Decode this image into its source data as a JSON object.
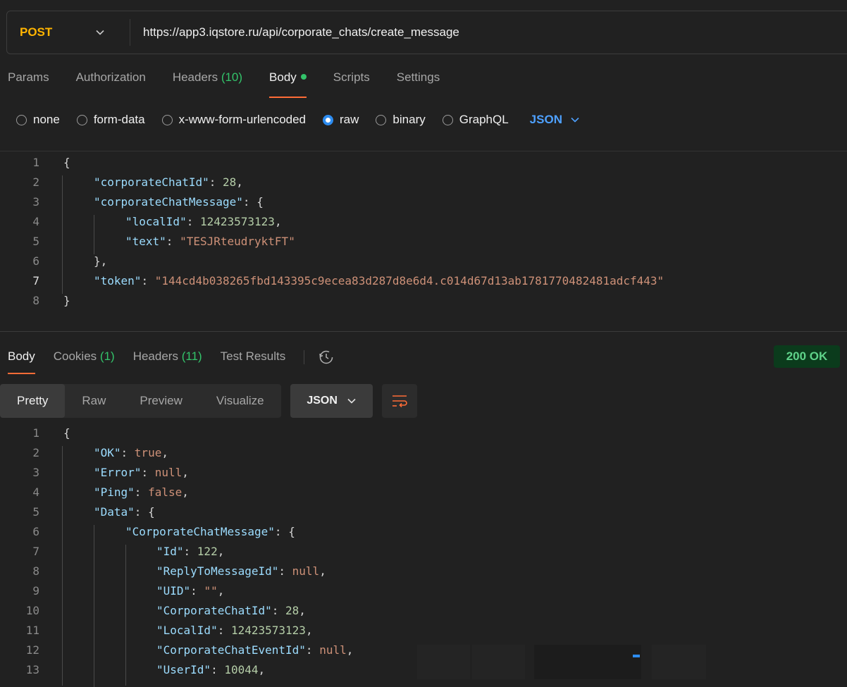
{
  "request": {
    "method": "POST",
    "url": "https://app3.iqstore.ru/api/corporate_chats/create_message"
  },
  "request_tabs": {
    "params": "Params",
    "authorization": "Authorization",
    "headers": "Headers",
    "headers_count": "(10)",
    "body": "Body",
    "scripts": "Scripts",
    "settings": "Settings"
  },
  "body_types": {
    "none": "none",
    "form_data": "form-data",
    "urlencoded": "x-www-form-urlencoded",
    "raw": "raw",
    "binary": "binary",
    "graphql": "GraphQL",
    "language": "JSON"
  },
  "request_body": {
    "line_numbers": [
      "1",
      "2",
      "3",
      "4",
      "5",
      "6",
      "7",
      "8"
    ],
    "corporateChatId_key": "\"corporateChatId\"",
    "corporateChatId_val": "28",
    "corporateChatMessage_key": "\"corporateChatMessage\"",
    "localId_key": "\"localId\"",
    "localId_val": "12423573123",
    "text_key": "\"text\"",
    "text_val": "\"TESJRteudryktFT\"",
    "token_key": "\"token\"",
    "token_val": "\"144cd4b038265fbd143395c9ecea83d287d8e6d4.c014d67d13ab1781770482481adcf443\""
  },
  "response_tabs": {
    "body": "Body",
    "cookies": "Cookies",
    "cookies_count": "(1)",
    "headers": "Headers",
    "headers_count": "(11)",
    "test_results": "Test Results",
    "status": "200 OK"
  },
  "response_view": {
    "pretty": "Pretty",
    "raw": "Raw",
    "preview": "Preview",
    "visualize": "Visualize",
    "format": "JSON"
  },
  "response_body": {
    "line_numbers": [
      "1",
      "2",
      "3",
      "4",
      "5",
      "6",
      "7",
      "8",
      "9",
      "10",
      "11",
      "12",
      "13"
    ],
    "ok_key": "\"OK\"",
    "ok_val": "true",
    "error_key": "\"Error\"",
    "error_val": "null",
    "ping_key": "\"Ping\"",
    "ping_val": "false",
    "data_key": "\"Data\"",
    "ccm_key": "\"CorporateChatMessage\"",
    "id_key": "\"Id\"",
    "id_val": "122",
    "reply_key": "\"ReplyToMessageId\"",
    "reply_val": "null",
    "uid_key": "\"UID\"",
    "uid_val": "\"\"",
    "chatid_key": "\"CorporateChatId\"",
    "chatid_val": "28",
    "localid_key": "\"LocalId\"",
    "localid_val": "12423573123",
    "eventid_key": "\"CorporateChatEventId\"",
    "eventid_val": "null",
    "userid_key": "\"UserId\"",
    "userid_val": "10044"
  }
}
